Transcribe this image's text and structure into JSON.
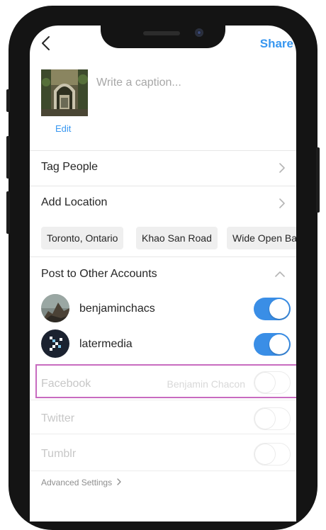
{
  "header": {
    "back_icon": "chevron-left-icon",
    "share_label": "Share"
  },
  "caption": {
    "placeholder": "Write a caption...",
    "edit_label": "Edit"
  },
  "rows": {
    "tag_people": "Tag People",
    "add_location": "Add Location"
  },
  "location_suggestions": [
    "Toronto, Ontario",
    "Khao San Road",
    "Wide Open Ba"
  ],
  "other_accounts": {
    "title": "Post to Other Accounts",
    "accounts": [
      {
        "name": "benjaminchacs",
        "enabled": true
      },
      {
        "name": "latermedia",
        "enabled": true
      }
    ]
  },
  "services": [
    {
      "name": "Facebook",
      "account": "Benjamin Chacon",
      "enabled": false
    },
    {
      "name": "Twitter",
      "enabled": false
    },
    {
      "name": "Tumblr",
      "enabled": false
    }
  ],
  "advanced_label": "Advanced Settings",
  "colors": {
    "accent": "#3897f0",
    "toggle_on": "#3a8ee6",
    "highlight": "#c86bc0"
  }
}
